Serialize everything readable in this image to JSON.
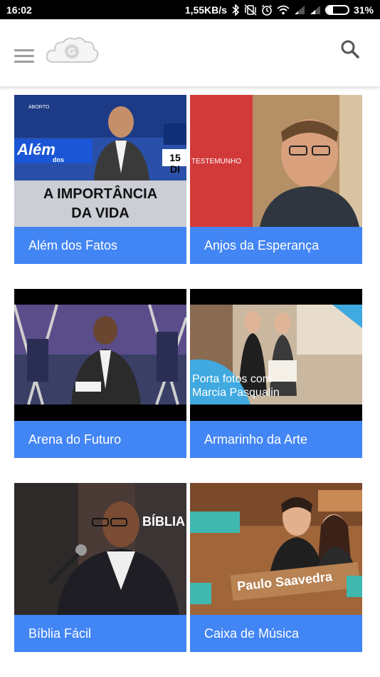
{
  "status_bar": {
    "time": "16:02",
    "network_speed": "1,55KB/s",
    "battery_percent": "31%",
    "battery_level": 0.31,
    "icons": [
      "bluetooth-icon",
      "vibrate-icon",
      "alarm-icon",
      "wifi-icon",
      "signal-icon",
      "signal-icon",
      "battery-icon"
    ]
  },
  "header": {
    "logo_letter": "G",
    "menu_icon": "hamburger-menu-icon",
    "search_icon": "search-icon"
  },
  "programs": [
    {
      "title": "Além dos Fatos",
      "thumb_text": {
        "line1": "A IMPORTÂNCIA",
        "line2": "DA VIDA",
        "banner": "Além",
        "banner_sub": "dos",
        "date": "15 DI",
        "corner": "ABORTO"
      }
    },
    {
      "title": "Anjos da Esperança",
      "thumb_text": {
        "tag": "TESTEMUNHO"
      }
    },
    {
      "title": "Arena do Futuro",
      "thumb_text": {}
    },
    {
      "title": "Armarinho da Arte",
      "thumb_text": {
        "line1": "Porta fotos com",
        "line2": "Marcia Pasqualin"
      }
    },
    {
      "title": "Bíblia Fácil",
      "thumb_text": {
        "wall": "BÍBLIA"
      }
    },
    {
      "title": "Caixa de Música",
      "thumb_text": {
        "sign": "Paulo Saavedra"
      }
    }
  ],
  "colors": {
    "card_label_bg": "#4285f4",
    "status_bar_bg": "#000000",
    "menu_icon": "#9e9e9e",
    "search_icon": "#555555"
  }
}
